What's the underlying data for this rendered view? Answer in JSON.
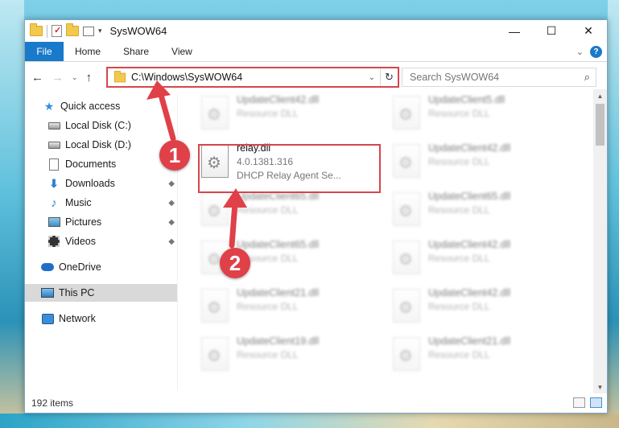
{
  "window": {
    "title": "SysWOW64",
    "controls": {
      "minimize": "—",
      "maximize": "☐",
      "close": "✕"
    }
  },
  "ribbon": {
    "tabs": [
      "File",
      "Home",
      "Share",
      "View"
    ],
    "collapse_glyph": "⌄",
    "help_glyph": "?"
  },
  "address": {
    "path": "C:\\Windows\\SysWOW64",
    "dropdown_glyph": "⌄",
    "refresh_glyph": "↻",
    "back_glyph": "←",
    "forward_glyph": "→",
    "recent_glyph": "⌄",
    "up_glyph": "↑"
  },
  "search": {
    "placeholder": "Search SysWOW64",
    "icon_glyph": "⌕"
  },
  "sidebar": {
    "items": [
      {
        "label": "Quick access",
        "icon": "star-icon",
        "pinned": false
      },
      {
        "label": "Local Disk (C:)",
        "icon": "disk-icon",
        "pinned": false
      },
      {
        "label": "Local Disk (D:)",
        "icon": "disk-icon",
        "pinned": false
      },
      {
        "label": "Documents",
        "icon": "documents-icon",
        "pinned": false
      },
      {
        "label": "Downloads",
        "icon": "download-icon",
        "pinned": true
      },
      {
        "label": "Music",
        "icon": "music-icon",
        "pinned": true
      },
      {
        "label": "Pictures",
        "icon": "pictures-icon",
        "pinned": true
      },
      {
        "label": "Videos",
        "icon": "videos-icon",
        "pinned": true
      },
      {
        "label": "OneDrive",
        "icon": "onedrive-icon",
        "pinned": false
      },
      {
        "label": "This PC",
        "icon": "pc-icon",
        "pinned": false,
        "selected": true
      },
      {
        "label": "Network",
        "icon": "network-icon",
        "pinned": false
      }
    ],
    "pin_glyph": "📌"
  },
  "files": [
    {
      "name": "UpdateClient42.dll",
      "sub": "Resource DLL",
      "blurred": true
    },
    {
      "name": "UpdateClient5.dll",
      "sub": "Resource DLL",
      "blurred": true
    },
    {
      "name": "relay.dll",
      "version": "4.0.1381.316",
      "description": "DHCP Relay Agent Se...",
      "blurred": false
    },
    {
      "name": "UpdateClient42.dll",
      "sub": "Resource DLL",
      "blurred": true
    },
    {
      "name": "UpdateClient65.dll",
      "sub": "Resource DLL",
      "blurred": true
    },
    {
      "name": "UpdateClient65.dll",
      "sub": "Resource DLL",
      "blurred": true
    },
    {
      "name": "UpdateClient65.dll",
      "sub": "Resource DLL",
      "blurred": true
    },
    {
      "name": "UpdateClient42.dll",
      "sub": "Resource DLL",
      "blurred": true
    },
    {
      "name": "UpdateClient21.dll",
      "sub": "Resource DLL",
      "blurred": true
    },
    {
      "name": "UpdateClient42.dll",
      "sub": "Resource DLL",
      "blurred": true
    },
    {
      "name": "UpdateClient19.dll",
      "sub": "Resource DLL",
      "blurred": true
    },
    {
      "name": "UpdateClient21.dll",
      "sub": "Resource DLL",
      "blurred": true
    }
  ],
  "status": {
    "item_count": "192 items"
  },
  "callouts": {
    "one": "1",
    "two": "2"
  },
  "scroll": {
    "up_glyph": "▲",
    "down_glyph": "▼"
  },
  "colors": {
    "accent": "#1979ca",
    "highlight": "#d6464d",
    "callout": "#e04048"
  }
}
